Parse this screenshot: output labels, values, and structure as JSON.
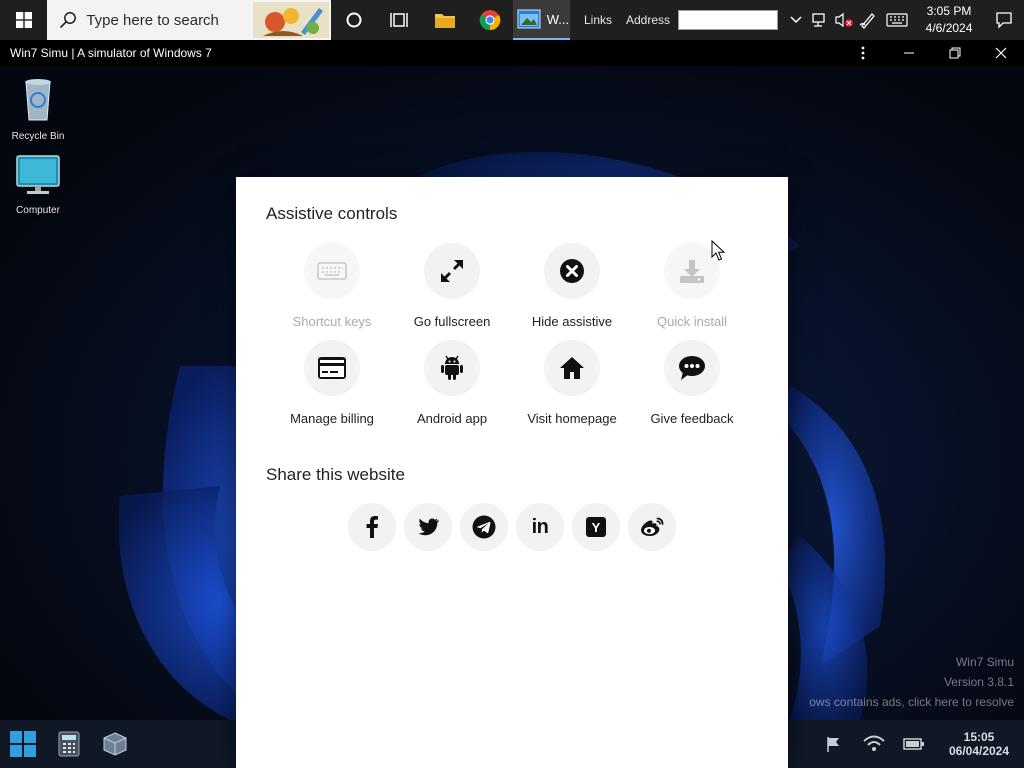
{
  "host_taskbar": {
    "search_placeholder": "Type here to search",
    "active_app_label": "W...",
    "links_label": "Links",
    "address_label": "Address",
    "address_value": "",
    "clock_time": "3:05 PM",
    "clock_date": "4/6/2024"
  },
  "window": {
    "title": "Win7 Simu | A simulator of Windows 7"
  },
  "desktop": {
    "icons": [
      {
        "label": "Recycle Bin",
        "icon": "recycle-bin-icon"
      },
      {
        "label": "Computer",
        "icon": "computer-icon"
      }
    ],
    "watermark": {
      "line1": "Win7 Simu",
      "line2": "Version 3.8.1",
      "line3": "ows contains ads, click here to resolve"
    }
  },
  "sim_taskbar": {
    "clock_time": "15:05",
    "clock_date": "06/04/2024"
  },
  "modal": {
    "controls_title": "Assistive controls",
    "controls": [
      {
        "label": "Shortcut keys",
        "icon": "keyboard-icon",
        "enabled": false
      },
      {
        "label": "Go fullscreen",
        "icon": "expand-icon",
        "enabled": true
      },
      {
        "label": "Hide assistive",
        "icon": "close-circle-icon",
        "enabled": true
      },
      {
        "label": "Quick install",
        "icon": "download-icon",
        "enabled": false
      },
      {
        "label": "Manage billing",
        "icon": "credit-card-icon",
        "enabled": true
      },
      {
        "label": "Android app",
        "icon": "android-icon",
        "enabled": true
      },
      {
        "label": "Visit homepage",
        "icon": "home-icon",
        "enabled": true
      },
      {
        "label": "Give feedback",
        "icon": "chat-icon",
        "enabled": true
      }
    ],
    "share_title": "Share this website",
    "share": [
      {
        "icon": "facebook-icon"
      },
      {
        "icon": "twitter-icon"
      },
      {
        "icon": "telegram-icon"
      },
      {
        "icon": "linkedin-icon",
        "text": "in"
      },
      {
        "icon": "hacker-news-icon",
        "text": "Y"
      },
      {
        "icon": "weibo-icon"
      }
    ]
  },
  "colors": {
    "host_taskbar": "#1f1f1f",
    "modal_bg": "#ffffff",
    "circle_bg": "#f2f2f2",
    "disabled_text": "#aaaaaa",
    "desktop_accent": "#1a4fd0"
  }
}
